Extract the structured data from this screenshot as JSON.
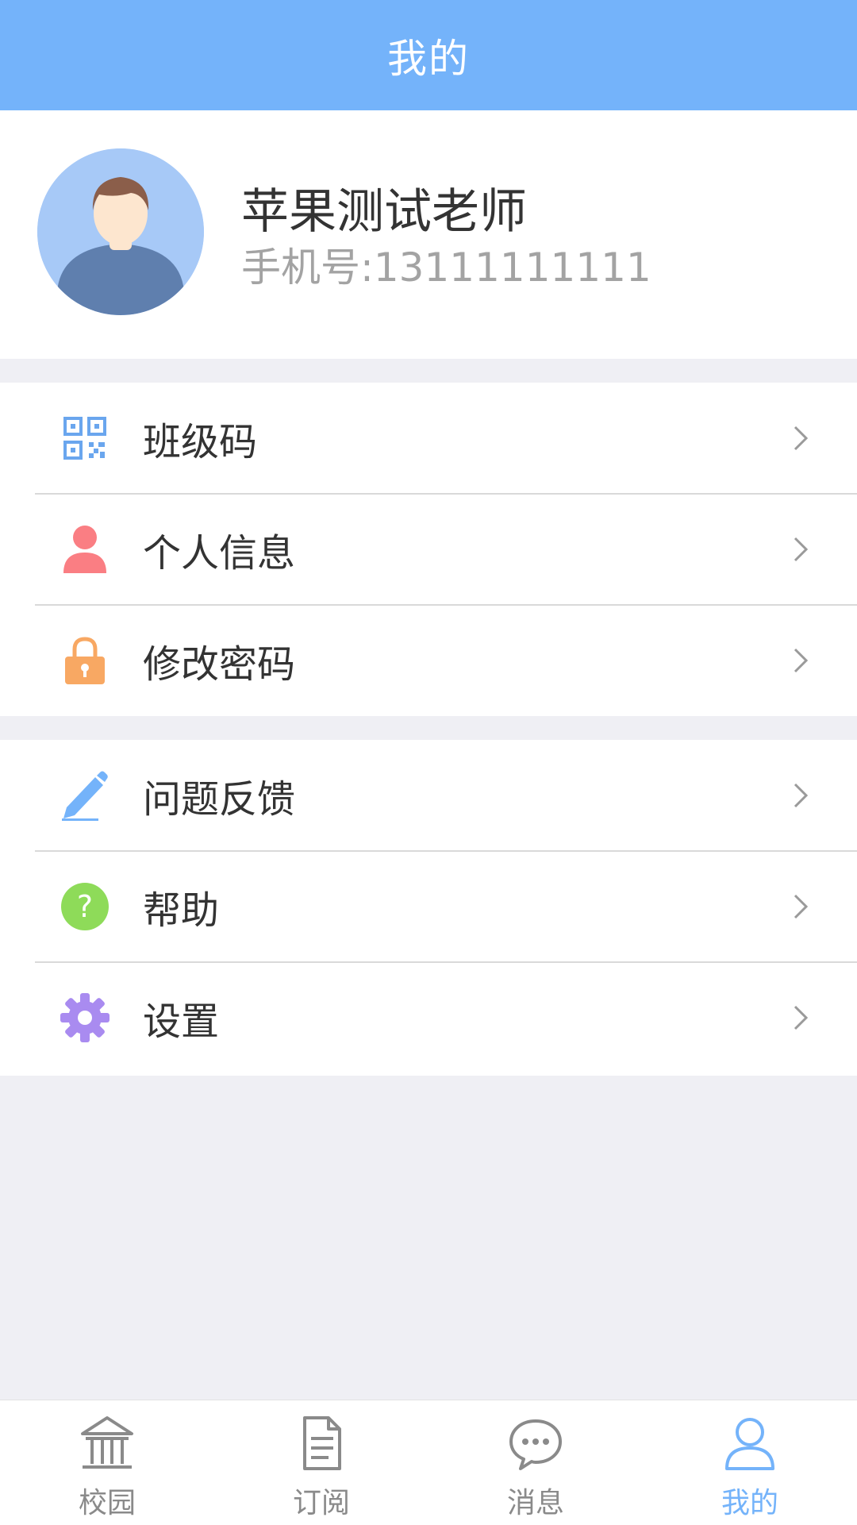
{
  "header": {
    "title": "我的"
  },
  "profile": {
    "name": "苹果测试老师",
    "phone": "手机号:13111111111"
  },
  "menu": {
    "group1": [
      {
        "label": "班级码",
        "icon": "qr-code-icon",
        "color": "#6aa6ee"
      },
      {
        "label": "个人信息",
        "icon": "person-icon",
        "color": "#fa7e83"
      },
      {
        "label": "修改密码",
        "icon": "lock-icon",
        "color": "#f8a863"
      }
    ],
    "group2": [
      {
        "label": "问题反馈",
        "icon": "pencil-icon",
        "color": "#74b3fa"
      },
      {
        "label": "帮助",
        "icon": "help-icon",
        "color": "#8edb59"
      },
      {
        "label": "设置",
        "icon": "gear-icon",
        "color": "#a98bf0"
      }
    ]
  },
  "tabbar": {
    "tabs": [
      {
        "label": "校园",
        "icon": "campus-icon"
      },
      {
        "label": "订阅",
        "icon": "document-icon"
      },
      {
        "label": "消息",
        "icon": "chat-bubble-icon"
      },
      {
        "label": "我的",
        "icon": "user-icon",
        "active": true
      }
    ]
  },
  "colors": {
    "accent": "#74b3fa",
    "background": "#efeff4",
    "inactive_tab": "#8a8a8a"
  }
}
